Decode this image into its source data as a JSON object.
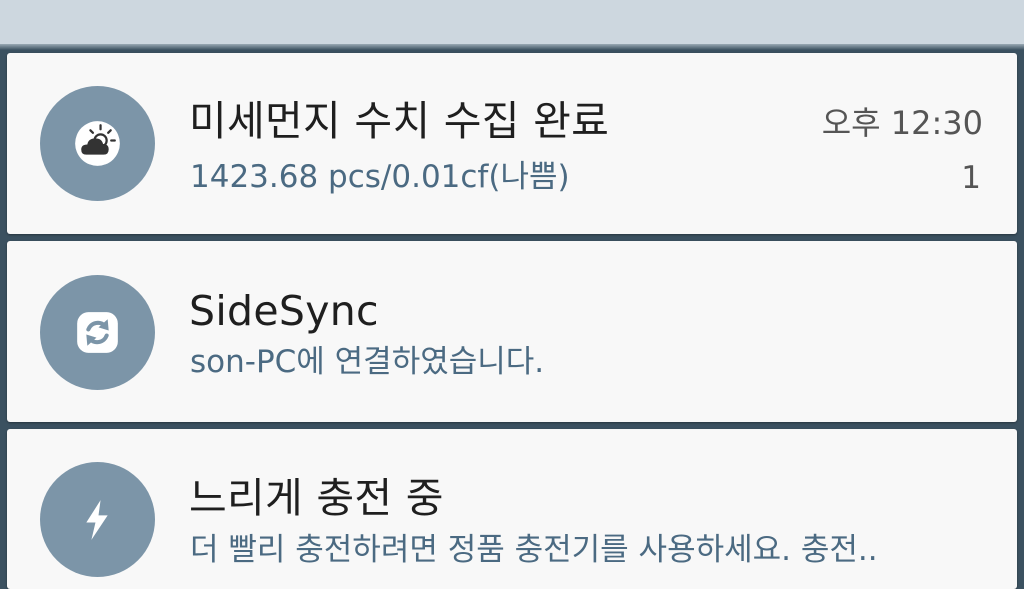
{
  "notifications": [
    {
      "icon": "weather-icon",
      "title": "미세먼지 수치 수집 완료",
      "subtitle": "1423.68 pcs/0.01cf(나쁨)",
      "time": "오후 12:30",
      "count": "1"
    },
    {
      "icon": "sync-icon",
      "title": "SideSync",
      "subtitle": "son-PC에 연결하였습니다."
    },
    {
      "icon": "lightning-bolt-icon",
      "title": "느리게 충전 중",
      "subtitle": "더 빨리 충전하려면 정품 충전기를 사용하세요. 충전.."
    }
  ],
  "colors": {
    "icon_circle": "#7c95a8",
    "card_background": "#f8f8f8",
    "subtitle_text": "#4b6a82",
    "panel_background": "#3b5160",
    "top_strip": "#cdd7df"
  }
}
